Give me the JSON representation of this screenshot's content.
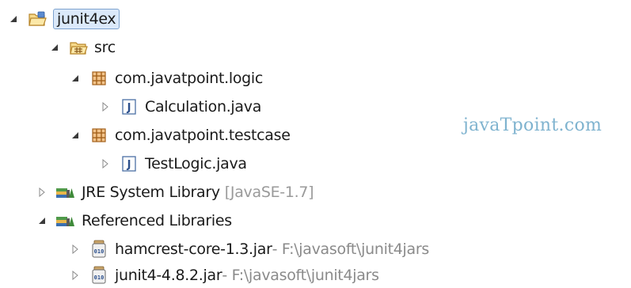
{
  "tree": {
    "project": {
      "label": "junit4ex"
    },
    "src": {
      "label": "src"
    },
    "pkg_logic": {
      "label": "com.javatpoint.logic"
    },
    "file_calc": {
      "label": "Calculation.java"
    },
    "pkg_testcase": {
      "label": "com.javatpoint.testcase"
    },
    "file_test": {
      "label": "TestLogic.java"
    },
    "jre": {
      "label": "JRE System Library",
      "decoration": "[JavaSE-1.7]"
    },
    "reflibs": {
      "label": "Referenced Libraries"
    },
    "jar_hamcrest": {
      "label": "hamcrest-core-1.3.jar",
      "decoration": " - F:\\javasoft\\junit4jars"
    },
    "jar_junit": {
      "label": "junit4-4.8.2.jar",
      "decoration": " - F:\\javasoft\\junit4jars"
    }
  },
  "watermark": "javaTpoint.com",
  "icons": {
    "expanded": "expanded-triangle-icon",
    "collapsed": "collapsed-triangle-icon",
    "project": "project-folder-icon",
    "source_folder": "source-folder-icon",
    "package": "package-icon",
    "java_file": "java-file-icon",
    "library": "library-icon",
    "jar": "jar-icon"
  },
  "colors": {
    "selection": "#dbe9fa",
    "selection_border": "#7da2ce",
    "decoration": "#9a9a9a",
    "watermark": "#7fb3cf"
  }
}
